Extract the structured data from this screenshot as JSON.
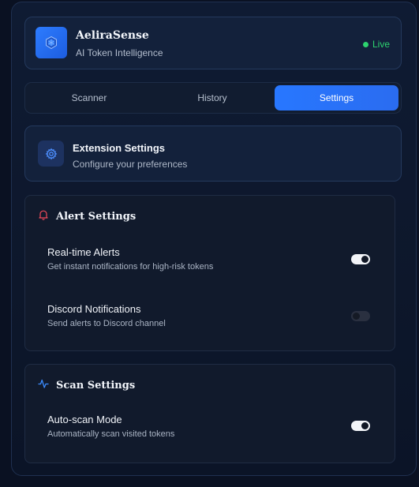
{
  "app": {
    "title": "AeliraSense",
    "subtitle": "AI Token Intelligence",
    "status": "Live",
    "status_color": "#2dd36f",
    "accent_color": "#2a6cf0",
    "logo_icon": "shield-cube-icon"
  },
  "tabs": [
    {
      "label": "Scanner",
      "active": false
    },
    {
      "label": "History",
      "active": false
    },
    {
      "label": "Settings",
      "active": true
    }
  ],
  "settings_header": {
    "title": "Extension Settings",
    "subtitle": "Configure your preferences",
    "icon": "gear-icon"
  },
  "sections": [
    {
      "title": "Alert Settings",
      "icon": "bell-icon",
      "icon_color": "#f04b5a",
      "items": [
        {
          "label": "Real-time Alerts",
          "description": "Get instant notifications for high-risk tokens",
          "enabled": true
        },
        {
          "label": "Discord Notifications",
          "description": "Send alerts to Discord channel",
          "enabled": false
        }
      ]
    },
    {
      "title": "Scan Settings",
      "icon": "activity-icon",
      "icon_color": "#3c8cff",
      "items": [
        {
          "label": "Auto-scan Mode",
          "description": "Automatically scan visited tokens",
          "enabled": true
        }
      ]
    }
  ]
}
